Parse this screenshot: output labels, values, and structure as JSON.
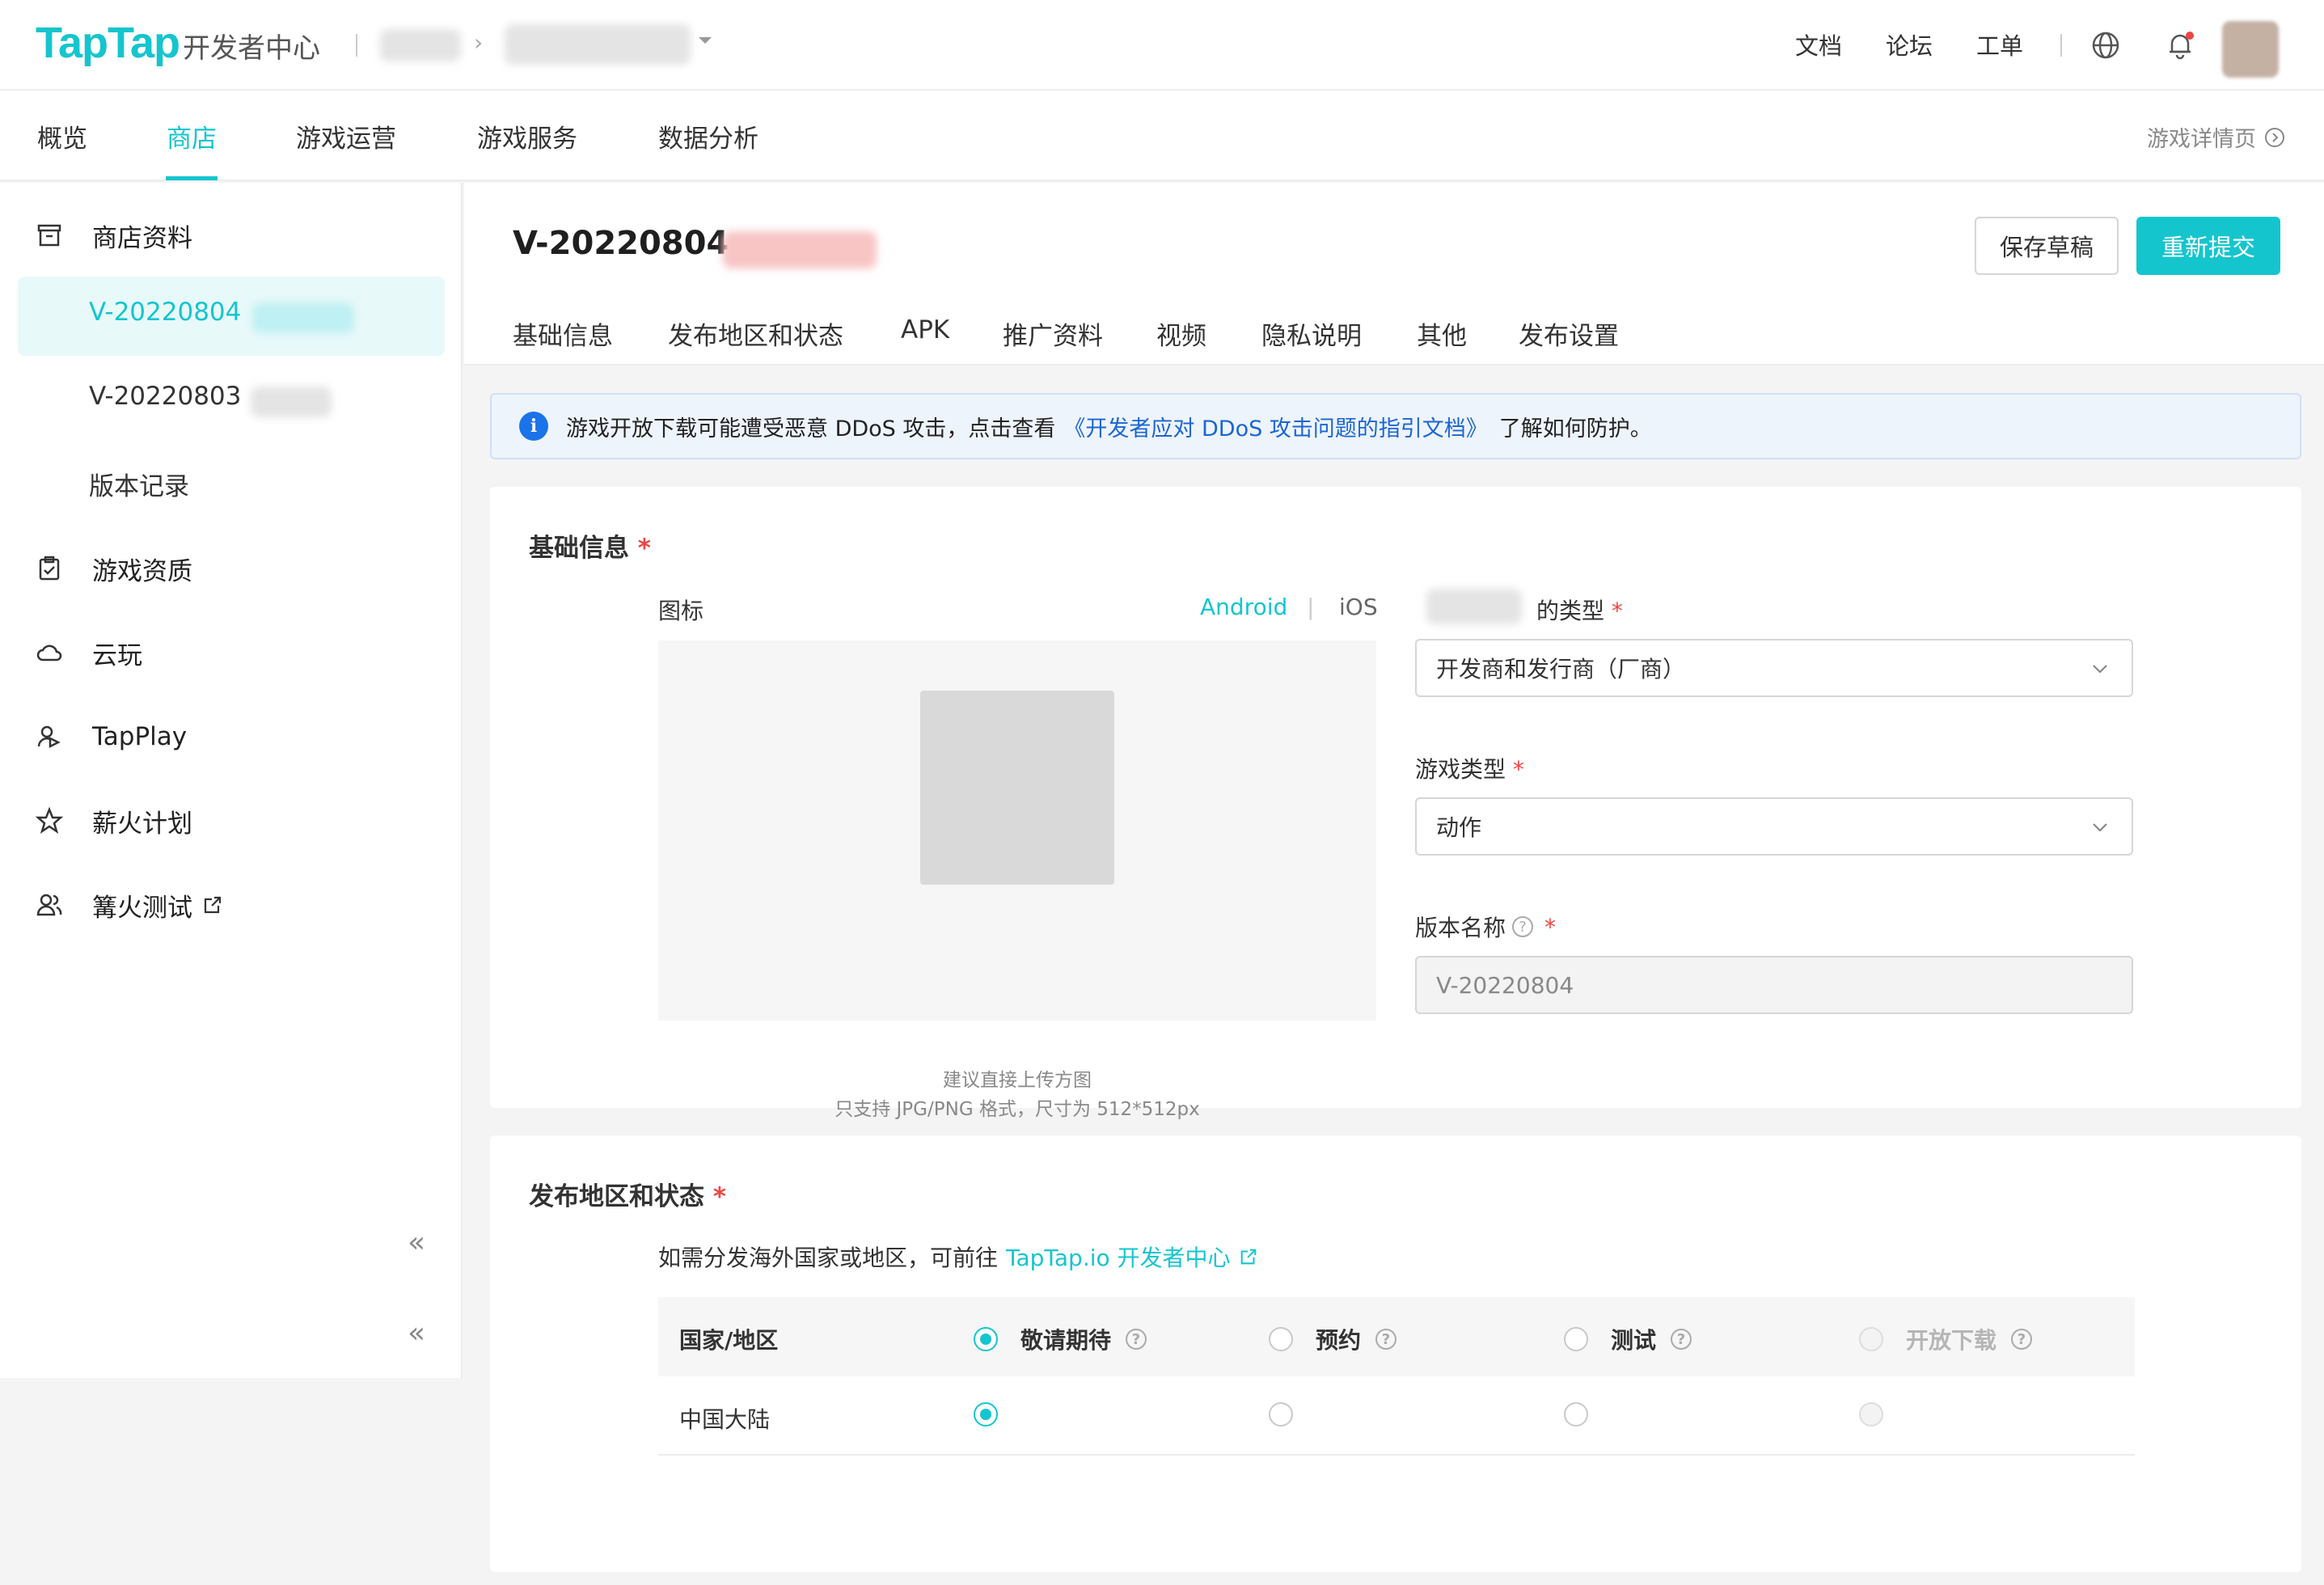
{
  "header": {
    "logo": "TapTap",
    "logo_sub": "开发者中心",
    "links": [
      "文档",
      "论坛",
      "工单"
    ],
    "icons": [
      "globe-icon",
      "bell-icon"
    ]
  },
  "nav": {
    "tabs": [
      "概览",
      "商店",
      "游戏运营",
      "游戏服务",
      "数据分析"
    ],
    "active": "商店",
    "right_link": "游戏详情页"
  },
  "sidebar": {
    "store_label": "商店资料",
    "versions": [
      "V-20220804",
      "V-20220803"
    ],
    "history": "版本记录",
    "items": [
      "游戏资质",
      "云玩",
      "TapPlay",
      "薪火计划",
      "篝火测试"
    ]
  },
  "content": {
    "version_title": "V-20220804",
    "save_draft": "保存草稿",
    "resubmit": "重新提交",
    "tabs": [
      "基础信息",
      "发布地区和状态",
      "APK",
      "推广资料",
      "视频",
      "隐私说明",
      "其他",
      "发布设置"
    ]
  },
  "banner": {
    "text_before": "游戏开放下载可能遭受恶意 DDoS 攻击，点击查看",
    "link": "《开发者应对 DDoS 攻击问题的指引文档》",
    "text_after": "了解如何防护。"
  },
  "basic": {
    "title": "基础信息",
    "required": "*",
    "icon_label": "图标",
    "platform_android": "Android",
    "platform_sep": "|",
    "platform_ios": "iOS",
    "upload_hint_1": "建议直接上传方图",
    "upload_hint_2": "只支持 JPG/PNG 格式，尺寸为 512*512px",
    "type_label": "的类型",
    "type_value": "开发商和发行商（厂商）",
    "game_type_label": "游戏类型",
    "game_type_value": "动作",
    "version_name_label": "版本名称",
    "version_name_value": "V-20220804"
  },
  "region": {
    "title": "发布地区和状态",
    "hint_text": "如需分发海外国家或地区，可前往",
    "hint_link": "TapTap.io 开发者中心",
    "col_region": "国家/地区",
    "col_status": [
      "敬请期待",
      "预约",
      "测试",
      "开放下载"
    ],
    "rows": [
      {
        "name": "中国大陆",
        "selected": 0
      }
    ]
  },
  "colors": {
    "accent": "#15c5ce",
    "link": "#1a66d2",
    "required": "#ef4444"
  }
}
